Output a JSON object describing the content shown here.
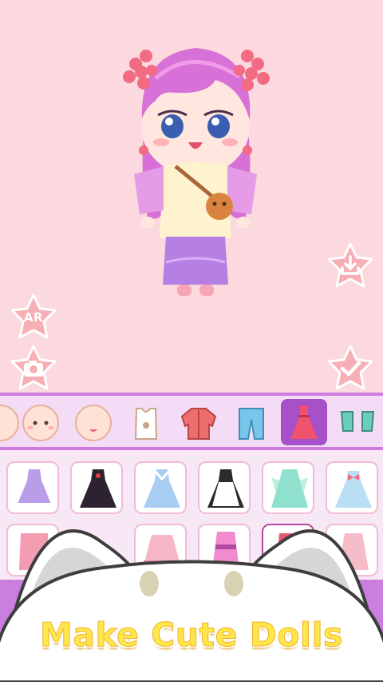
{
  "buttons": {
    "ar_label": "AR",
    "download_icon": "download-icon",
    "camera_icon": "camera-icon",
    "confirm_icon": "check-icon"
  },
  "categories": [
    {
      "name": "face-partial",
      "selected": false
    },
    {
      "name": "face-expression",
      "selected": false
    },
    {
      "name": "face-base",
      "selected": false
    },
    {
      "name": "top-tank",
      "selected": false
    },
    {
      "name": "jacket",
      "selected": false
    },
    {
      "name": "pants",
      "selected": false
    },
    {
      "name": "dress",
      "selected": true
    },
    {
      "name": "socks",
      "selected": false
    }
  ],
  "items": [
    {
      "name": "purple-lolita-dress"
    },
    {
      "name": "black-gothic-dress"
    },
    {
      "name": "blue-sailor-dress"
    },
    {
      "name": "maid-dress"
    },
    {
      "name": "mint-hanfu-dress"
    },
    {
      "name": "blue-bow-dress"
    },
    {
      "name": "pink-outfit"
    },
    {
      "name": "pink-ruffle-skirt"
    },
    {
      "name": "pink-kimono"
    },
    {
      "name": "red-outfit"
    },
    {
      "name": "pink-coat"
    }
  ],
  "colors": {
    "background": "#fbd9de",
    "accent": "#a650c9",
    "star_button": "#f7aeb4",
    "title": "#ffe64a"
  },
  "banner": {
    "title": "Make Cute Dolls",
    "mascot": "white-cat-mascot"
  }
}
